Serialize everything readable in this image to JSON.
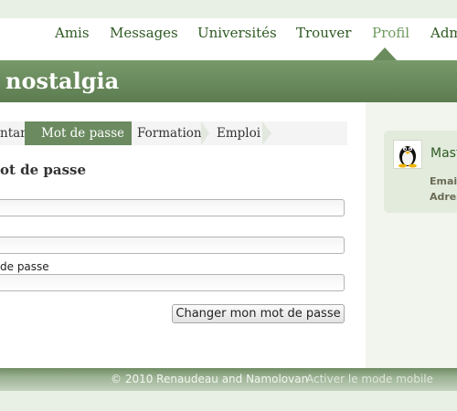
{
  "nav": {
    "items": [
      {
        "label": "Amis"
      },
      {
        "label": "Messages"
      },
      {
        "label": "Universités"
      },
      {
        "label": "Trouver"
      },
      {
        "label": "Profil",
        "active": true
      },
      {
        "label": "Adm"
      }
    ]
  },
  "banner": {
    "title": "nostalgia"
  },
  "steps": {
    "items": [
      {
        "label": "ntar"
      },
      {
        "label": "Mot de passe",
        "active": true
      },
      {
        "label": "Formation"
      },
      {
        "label": "Emploi"
      }
    ]
  },
  "form": {
    "title": "ot de passe",
    "field3_label": "de passe",
    "submit_label": "Changer mon mot de passe"
  },
  "sidebar": {
    "name": "Mast",
    "line1": "Emai",
    "line2": "Adres"
  },
  "footer": {
    "copyright": "© 2010 Renaudeau and Namolovan",
    "mobile_link": "Activer le mode mobile"
  },
  "colors": {
    "brand_green": "#5c7c50",
    "nav_text": "#2e5a22",
    "active_nav": "#6e9a5e",
    "sidebar_bg": "#f1f5ee"
  }
}
